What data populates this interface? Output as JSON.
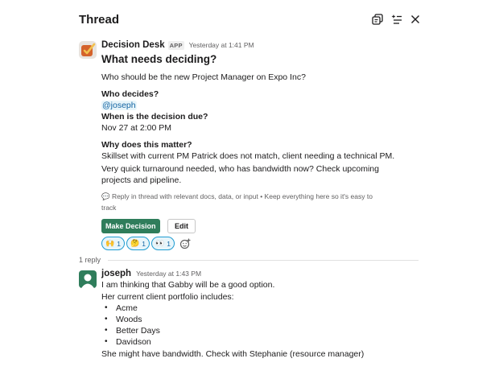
{
  "header": {
    "title": "Thread",
    "icons": [
      "open-in-channel-icon",
      "ai-summary-icon",
      "close-icon"
    ]
  },
  "parent_message": {
    "author": "Decision Desk",
    "badge": "APP",
    "timestamp": "Yesterday at 1:41 PM",
    "heading": "What needs deciding?",
    "question": "Who should be the new Project Manager on Expo Inc?",
    "who_decides_label": "Who decides?",
    "who_decides_value": "@joseph",
    "due_label": "When is the decision due?",
    "due_value": "Nov 27 at 2:00 PM",
    "why_label": "Why does this matter?",
    "why_lines": [
      "Skillset with current PM Patrick does not match, client needing a technical PM.",
      "Very quick turnaround needed, who has bandwidth now? Check upcoming",
      "projects and pipeline."
    ],
    "hint_lines": [
      "💬 Reply in thread with relevant docs, data, or input • Keep everything here so it's easy to",
      "track"
    ],
    "buttons": {
      "primary": "Make Decision",
      "secondary": "Edit"
    },
    "reactions": [
      {
        "emoji": "🙌",
        "count": "1"
      },
      {
        "emoji": "🤔",
        "count": "1"
      },
      {
        "emoji": "👀",
        "count": "1"
      }
    ]
  },
  "replies": {
    "count_label": "1 reply"
  },
  "reply_message": {
    "author": "joseph",
    "timestamp": "Yesterday at 1:43 PM",
    "lines": [
      "I am thinking that Gabby will be a good option.",
      "Her current client portfolio includes:"
    ],
    "list": [
      "Acme",
      "Woods",
      "Better Days",
      "Davidson"
    ],
    "closing": "She might have bandwidth. Check with Stephanie (resource manager)"
  },
  "colors": {
    "accent_green": "#2f7d5b",
    "mention_blue": "#1264a3",
    "reaction_border": "#1d9bd1",
    "app_icon_orange": "#d4622b"
  }
}
